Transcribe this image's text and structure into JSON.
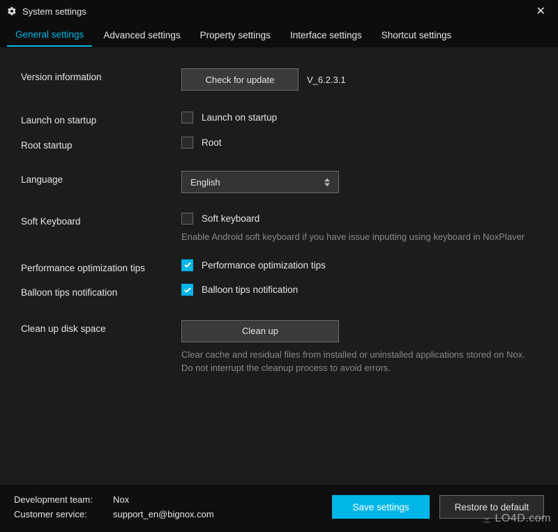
{
  "titlebar": {
    "title": "System settings"
  },
  "tabs": [
    {
      "label": "General settings",
      "active": true
    },
    {
      "label": "Advanced settings",
      "active": false
    },
    {
      "label": "Property settings",
      "active": false
    },
    {
      "label": "Interface settings",
      "active": false
    },
    {
      "label": "Shortcut settings",
      "active": false
    }
  ],
  "rows": {
    "version": {
      "label": "Version information",
      "button": "Check for update",
      "value": "V_6.2.3.1"
    },
    "launch": {
      "label": "Launch on startup",
      "check_label": "Launch on startup",
      "checked": false
    },
    "root": {
      "label": "Root startup",
      "check_label": "Root",
      "checked": false
    },
    "language": {
      "label": "Language",
      "value": "English"
    },
    "soft_keyboard": {
      "label": "Soft Keyboard",
      "check_label": "Soft keyboard",
      "checked": false,
      "hint": "Enable Android soft keyboard if you have issue inputting using keyboard in NoxPlaver"
    },
    "perf_tips": {
      "label": "Performance optimization tips",
      "check_label": "Performance optimization tips",
      "checked": true
    },
    "balloon": {
      "label": "Balloon tips notification",
      "check_label": "Balloon tips notification",
      "checked": true
    },
    "cleanup": {
      "label": "Clean up disk space",
      "button": "Clean up",
      "hint": "Clear cache and residual files from installed or uninstalled applications stored on Nox. Do not interrupt the cleanup process to avoid errors."
    }
  },
  "footer": {
    "dev_label": "Development team:",
    "dev_value": "Nox",
    "cs_label": "Customer service:",
    "cs_value": "support_en@bignox.com",
    "save": "Save settings",
    "restore": "Restore to default"
  },
  "watermark": "LO4D.com"
}
